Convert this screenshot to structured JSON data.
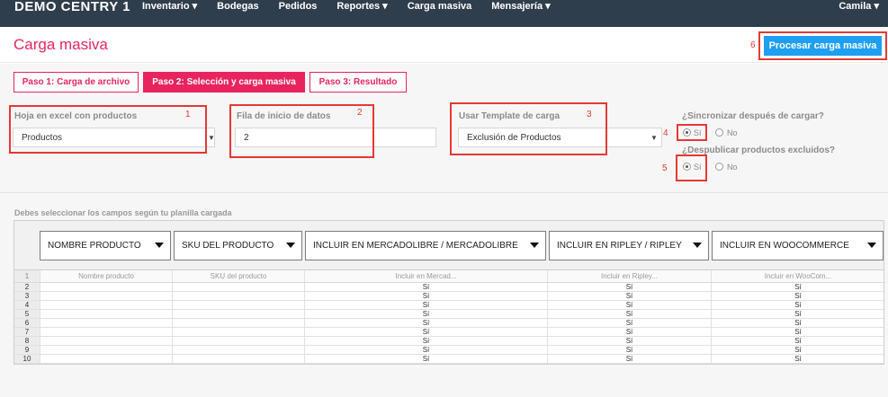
{
  "topbar": {
    "brand": "DEMO CENTRY 1",
    "nav": [
      "Inventario ▾",
      "Bodegas",
      "Pedidos",
      "Reportes ▾",
      "Carga masiva",
      "Mensajería ▾"
    ],
    "user": "Camila ▾"
  },
  "page": {
    "title": "Carga masiva",
    "process_button": "Procesar carga masiva"
  },
  "steps": [
    "Paso 1: Carga de archivo",
    "Paso 2: Selección y carga masiva",
    "Paso 3: Resultado"
  ],
  "active_step": 2,
  "form": {
    "sheet_label": "Hoja en excel con productos",
    "sheet_value": "Productos",
    "start_row_label": "Fila de inicio de datos",
    "start_row_value": "2",
    "template_label": "Usar Template de carga",
    "template_value": "Exclusión de Productos",
    "sync_label": "¿Sincronizar después de cargar?",
    "unpublish_label": "¿Despublicar productos excluidos?",
    "yes": "Sí",
    "no": "No",
    "sync_selected": "Sí",
    "unpublish_selected": "Sí"
  },
  "annotations": [
    "1",
    "2",
    "3",
    "4",
    "5",
    "6"
  ],
  "mapping_note": "Debes seleccionar los campos según tu planilla cargada",
  "table": {
    "mappings": [
      "NOMBRE PRODUCTO",
      "SKU DEL PRODUCTO",
      "INCLUIR EN MERCADOLIBRE / MERCADOLIBRE",
      "INCLUIR EN RIPLEY / RIPLEY",
      "INCLUIR EN WOOCOMMERCE"
    ],
    "header_row": [
      "Nombre producto",
      "SKU del producto",
      "Incluir en Mercad...",
      "Incluir en Ripley...",
      "Incluir en WooCom..."
    ],
    "row_numbers": [
      "1",
      "2",
      "3",
      "4",
      "5",
      "6",
      "7",
      "8",
      "9",
      "10"
    ],
    "rows": [
      [
        "",
        "",
        "Sí",
        "Sí",
        "Sí"
      ],
      [
        "",
        "",
        "Sí",
        "Sí",
        "Sí"
      ],
      [
        "",
        "",
        "Sí",
        "Sí",
        "Sí"
      ],
      [
        "",
        "",
        "Sí",
        "Sí",
        "Sí"
      ],
      [
        "",
        "",
        "Sí",
        "Sí",
        "Sí"
      ],
      [
        "",
        "",
        "Sí",
        "Sí",
        "Sí"
      ],
      [
        "",
        "",
        "Sí",
        "Sí",
        "Sí"
      ],
      [
        "",
        "",
        "Sí",
        "Sí",
        "Sí"
      ],
      [
        "",
        "",
        "Sí",
        "Sí",
        "Sí"
      ]
    ]
  },
  "colors": {
    "accent": "#e8245f",
    "topbar": "#2f3e4c",
    "button": "#1e9ff2",
    "annotation": "#e53935"
  }
}
